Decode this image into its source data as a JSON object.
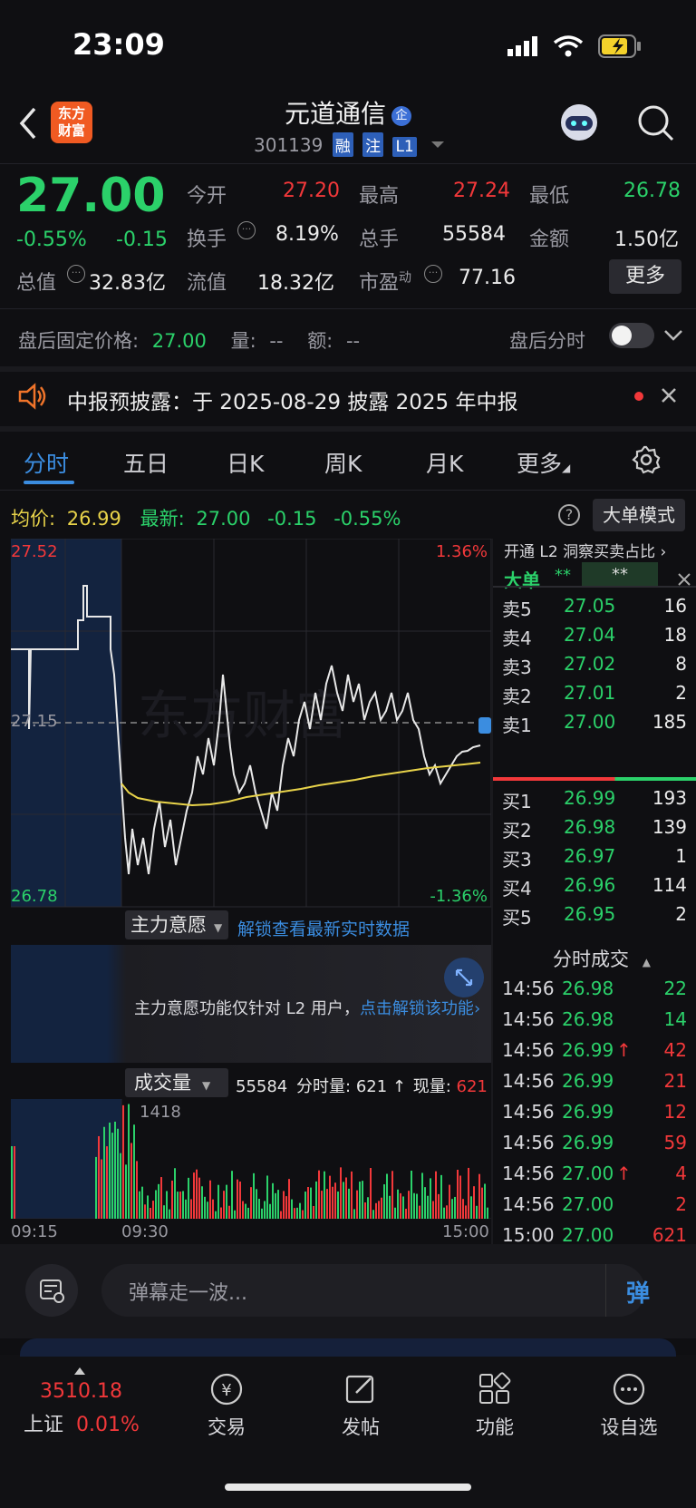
{
  "status_bar": {
    "time": "23:09"
  },
  "header": {
    "logo_text": "东方\n财富",
    "title": "元道通信",
    "code": "301139",
    "tags": [
      "融",
      "注",
      "L1"
    ]
  },
  "quote": {
    "price": "27.00",
    "change_pct": "-0.55%",
    "change": "-0.15",
    "open_label": "今开",
    "open": "27.20",
    "high_label": "最高",
    "high": "27.24",
    "low_label": "最低",
    "low": "26.78",
    "turnover_label": "换手",
    "turnover": "8.19%",
    "volume_label": "总手",
    "volume": "55584",
    "amount_label": "金额",
    "amount": "1.50亿",
    "mktcap_label": "总值",
    "mktcap": "32.83亿",
    "float_label": "流值",
    "float": "18.32亿",
    "pe_label": "市盈",
    "pe_sup": "动",
    "pe": "77.16",
    "more_label": "更多"
  },
  "after_hours": {
    "price_label": "盘后固定价格:",
    "price": "27.00",
    "vol_label": "量:",
    "vol": "--",
    "amt_label": "额:",
    "amt": "--",
    "toggle_label": "盘后分时"
  },
  "notice": {
    "text": "中报预披露：于 2025-08-29 披露 2025 年中报"
  },
  "tabs": [
    "分时",
    "五日",
    "日K",
    "周K",
    "月K",
    "更多"
  ],
  "chart_info": {
    "avg_label": "均价:",
    "avg": "26.99",
    "latest_label": "最新:",
    "latest": "27.00",
    "chg": "-0.15",
    "chg_pct": "-0.55%",
    "big_order_mode": "大单模式",
    "y_top": "27.52",
    "y_mid": "27.15",
    "y_bot": "26.78",
    "pct_top": "1.36%",
    "pct_bot": "-1.36%",
    "watermark": "东方财富",
    "main_force_label": "主力意愿",
    "unlock_link": "解锁查看最新实时数据",
    "l2_notice": "主力意愿功能仅针对 L2 用户，",
    "l2_link": "点击解锁该功能",
    "vol_label": "成交量",
    "vol_total": "55584",
    "minute_vol_label": "分时量:",
    "minute_vol": "621",
    "cur_vol_label": "现量:",
    "cur_vol": "621",
    "vol_max": "1418",
    "x_labels": [
      "09:15",
      "09:30",
      "15:00"
    ]
  },
  "orderbook": {
    "l2_banner": "开通 L2 洞察买卖占比",
    "big_label": "大单",
    "big_val1": "**",
    "big_val2": "**",
    "sells": [
      {
        "label": "卖5",
        "price": "27.05",
        "vol": "16"
      },
      {
        "label": "卖4",
        "price": "27.04",
        "vol": "18"
      },
      {
        "label": "卖3",
        "price": "27.02",
        "vol": "8"
      },
      {
        "label": "卖2",
        "price": "27.01",
        "vol": "2"
      },
      {
        "label": "卖1",
        "price": "27.00",
        "vol": "185"
      }
    ],
    "buys": [
      {
        "label": "买1",
        "price": "26.99",
        "vol": "193"
      },
      {
        "label": "买2",
        "price": "26.98",
        "vol": "139"
      },
      {
        "label": "买3",
        "price": "26.97",
        "vol": "1"
      },
      {
        "label": "买4",
        "price": "26.96",
        "vol": "114"
      },
      {
        "label": "买5",
        "price": "26.95",
        "vol": "2"
      }
    ],
    "trades_title": "分时成交",
    "trades": [
      {
        "time": "14:56",
        "price": "26.98",
        "vol": "22",
        "dir": "",
        "color": "green"
      },
      {
        "time": "14:56",
        "price": "26.98",
        "vol": "14",
        "dir": "",
        "color": "green"
      },
      {
        "time": "14:56",
        "price": "26.99",
        "vol": "42",
        "dir": "↑",
        "color": "red"
      },
      {
        "time": "14:56",
        "price": "26.99",
        "vol": "21",
        "dir": "",
        "color": "red"
      },
      {
        "time": "14:56",
        "price": "26.99",
        "vol": "12",
        "dir": "",
        "color": "red"
      },
      {
        "time": "14:56",
        "price": "26.99",
        "vol": "59",
        "dir": "",
        "color": "red"
      },
      {
        "time": "14:56",
        "price": "27.00",
        "vol": "4",
        "dir": "↑",
        "color": "red"
      },
      {
        "time": "14:56",
        "price": "27.00",
        "vol": "2",
        "dir": "",
        "color": "red"
      },
      {
        "time": "15:00",
        "price": "27.00",
        "vol": "621",
        "dir": "",
        "color": "red"
      }
    ]
  },
  "comment_bar": {
    "placeholder": "弹幕走一波...",
    "send_label": "弹"
  },
  "bottom_nav": {
    "index_value": "3510.18",
    "index_name": "上证",
    "index_pct": "0.01%",
    "items": [
      "交易",
      "发帖",
      "功能",
      "设自选"
    ]
  }
}
